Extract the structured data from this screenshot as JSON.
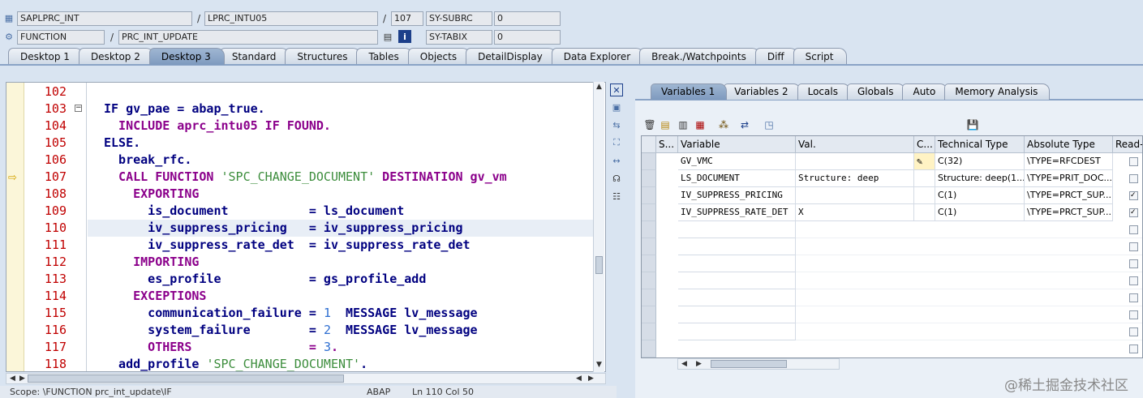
{
  "header": {
    "row1": {
      "program": "SAPLPRC_INT",
      "include": "LPRC_INTU05",
      "line": "107",
      "sysvar": "SY-SUBRC",
      "sysval": "0"
    },
    "row2": {
      "type": "FUNCTION",
      "name": "PRC_INT_UPDATE",
      "sysvar": "SY-TABIX",
      "sysval": "0"
    },
    "sep": "/"
  },
  "tabs": [
    "Desktop 1",
    "Desktop 2",
    "Desktop 3",
    "Standard",
    "Structures",
    "Tables",
    "Objects",
    "DetailDisplay",
    "Data Explorer",
    "Break./Watchpoints",
    "Diff",
    "Script"
  ],
  "active_tab": "Desktop 3",
  "code": {
    "lines": [
      {
        "n": "102",
        "t": ""
      },
      {
        "n": "103",
        "t": "IF gv_pae = abap_true."
      },
      {
        "n": "104",
        "t": "  INCLUDE aprc_intu05 IF FOUND."
      },
      {
        "n": "105",
        "t": "ELSE."
      },
      {
        "n": "106",
        "t": "  break_rfc."
      },
      {
        "n": "107",
        "t": "  CALL FUNCTION 'SPC_CHANGE_DOCUMENT' DESTINATION gv_vm"
      },
      {
        "n": "108",
        "t": "    EXPORTING"
      },
      {
        "n": "109",
        "t": "      is_document           = ls_document"
      },
      {
        "n": "110",
        "t": "      iv_suppress_pricing   = iv_suppress_pricing"
      },
      {
        "n": "111",
        "t": "      iv_suppress_rate_det  = iv_suppress_rate_det"
      },
      {
        "n": "112",
        "t": "    IMPORTING"
      },
      {
        "n": "113",
        "t": "      es_profile            = gs_profile_add"
      },
      {
        "n": "114",
        "t": "    EXCEPTIONS"
      },
      {
        "n": "115",
        "t": "      communication_failure = 1  MESSAGE lv_message"
      },
      {
        "n": "116",
        "t": "      system_failure        = 2  MESSAGE lv_message"
      },
      {
        "n": "117",
        "t": "      OTHERS                = 3."
      },
      {
        "n": "118",
        "t": "  add_profile 'SPC_CHANGE_DOCUMENT'."
      }
    ]
  },
  "status": {
    "scope": "Scope: \\FUNCTION prc_int_update\\IF",
    "lang": "ABAP",
    "pos": "Ln 110 Col 50"
  },
  "right_tabs": [
    "Variables 1",
    "Variables 2",
    "Locals",
    "Globals",
    "Auto",
    "Memory Analysis"
  ],
  "right_active": "Variables 1",
  "grid": {
    "headers": [
      "S...",
      "Variable",
      "Val.",
      "C...",
      "Technical Type",
      "Absolute Type",
      "Read-O"
    ],
    "rows": [
      {
        "var": "GV_VMC",
        "val": "",
        "tech": "C(32)",
        "abs": "\\TYPE=RFCDEST"
      },
      {
        "var": "LS_DOCUMENT",
        "val": "Structure: deep",
        "tech": "Structure: deep(1...",
        "abs": "\\TYPE=PRIT_DOC..."
      },
      {
        "var": "IV_SUPPRESS_PRICING",
        "val": "",
        "tech": "C(1)",
        "abs": "\\TYPE=PRCT_SUP..."
      },
      {
        "var": "IV_SUPPRESS_RATE_DET",
        "val": "X",
        "tech": "C(1)",
        "abs": "\\TYPE=PRCT_SUP..."
      }
    ]
  },
  "watermark": "@稀土掘金技术社区",
  "colors": {
    "tab_active": "#7e9abf",
    "line_numbers": "#c00000",
    "keyword": "#8b008b",
    "string": "#3c8d3c"
  }
}
